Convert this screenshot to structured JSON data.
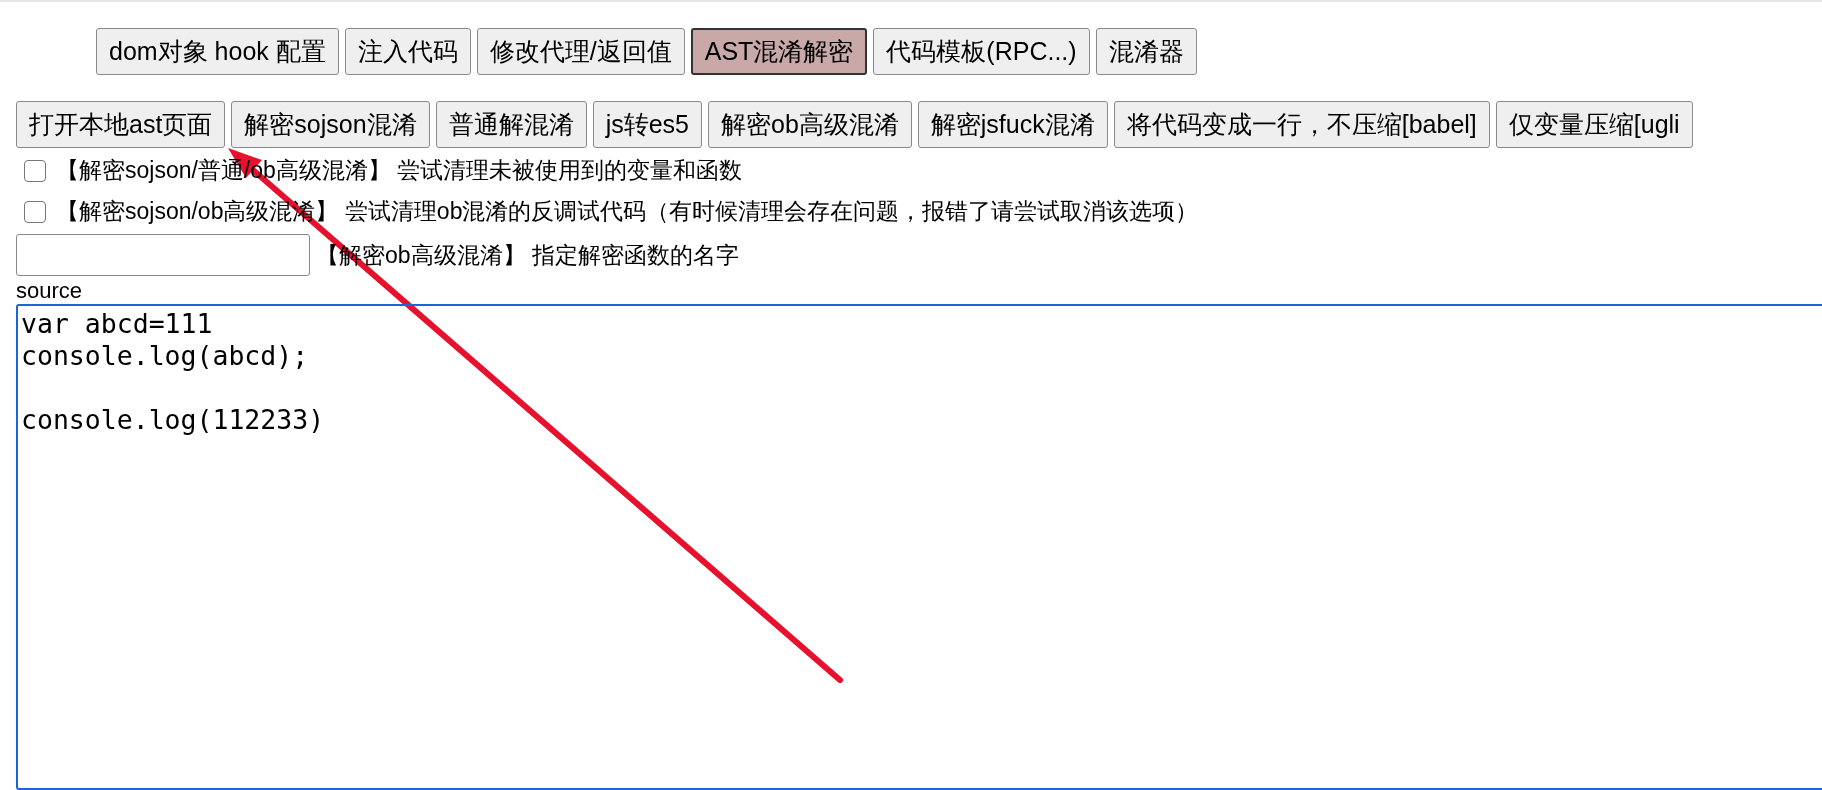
{
  "tabs": [
    {
      "label": "dom对象 hook 配置",
      "selected": false
    },
    {
      "label": "注入代码",
      "selected": false
    },
    {
      "label": "修改代理/返回值",
      "selected": false
    },
    {
      "label": "AST混淆解密",
      "selected": true
    },
    {
      "label": "代码模板(RPC...)",
      "selected": false
    },
    {
      "label": "混淆器",
      "selected": false
    }
  ],
  "actions": [
    "打开本地ast页面",
    "解密sojson混淆",
    "普通解混淆",
    "js转es5",
    "解密ob高级混淆",
    "解密jsfuck混淆",
    "将代码变成一行，不压缩[babel]",
    "仅变量压缩[ugli"
  ],
  "options": [
    {
      "label": "【解密sojson/普通/ob高级混淆】 尝试清理未被使用到的变量和函数",
      "checked": false
    },
    {
      "label": "【解密sojson/ob高级混淆】 尝试清理ob混淆的反调试代码（有时候清理会存在问题，报错了请尝试取消该选项）",
      "checked": false
    }
  ],
  "decoder_name": {
    "label": "【解密ob高级混淆】 指定解密函数的名字"
  },
  "source": {
    "label": "source",
    "value": "var abcd=111\nconsole.log(abcd);\n\nconsole.log(112233)"
  }
}
